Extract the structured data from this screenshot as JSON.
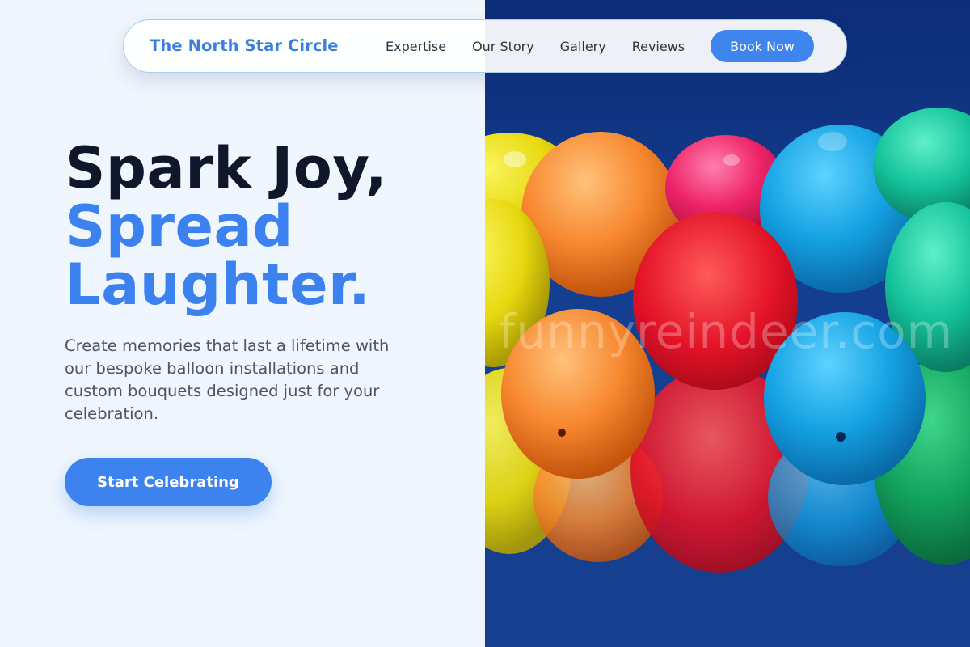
{
  "nav": {
    "brand": "The North Star Circle",
    "links": [
      "Expertise",
      "Our Story",
      "Gallery",
      "Reviews"
    ],
    "cta_label": "Book Now"
  },
  "hero": {
    "headline_line1": "Spark Joy,",
    "headline_line2": "Spread",
    "headline_line3": "Laughter.",
    "subtitle": "Create memories that last a lifetime with our bespoke balloon installations and custom bouquets designed just for your celebration.",
    "cta_label": "Start Celebrating"
  },
  "image": {
    "watermark": "funnyreindeer.com",
    "subject": "colorful balloons against blue sky"
  },
  "colors": {
    "accent": "#3b82f0",
    "headline_dark": "#0f172a",
    "page_bg": "#eff6fd",
    "sky": "#143f90"
  }
}
